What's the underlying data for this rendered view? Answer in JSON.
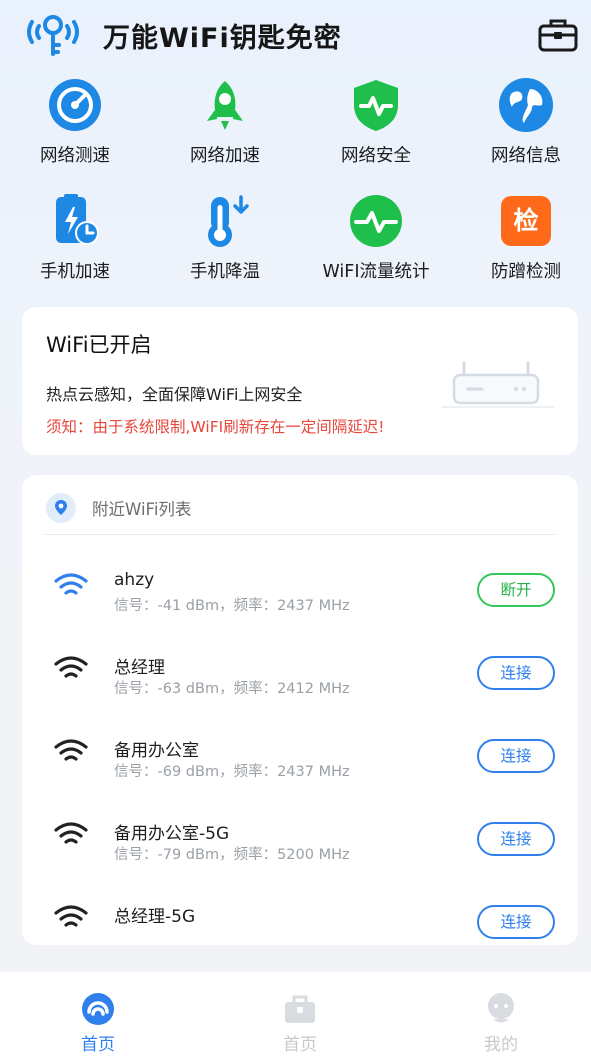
{
  "app_title": "万能WiFi钥匙免密",
  "icons": {
    "logo": "wifi-key-icon",
    "toolbox": "toolbox-icon"
  },
  "tools": [
    {
      "label": "网络测速",
      "icon": "speedometer-icon",
      "color": "#1e88e5"
    },
    {
      "label": "网络加速",
      "icon": "rocket-icon",
      "color": "#1fbf4b"
    },
    {
      "label": "网络安全",
      "icon": "shield-pulse-icon",
      "color": "#1fbf4b"
    },
    {
      "label": "网络信息",
      "icon": "globe-icon",
      "color": "#1e88e5"
    },
    {
      "label": "手机加速",
      "icon": "phone-boost-icon",
      "color": "#1e88e5"
    },
    {
      "label": "手机降温",
      "icon": "thermometer-icon",
      "color": "#1e88e5"
    },
    {
      "label": "WiFI流量统计",
      "icon": "traffic-pulse-icon",
      "color": "#1fbf4b"
    },
    {
      "label": "防蹭检测",
      "icon": "check-badge-icon",
      "badge_text": "检",
      "color": "#ff6a1a"
    }
  ],
  "status": {
    "title": "WiFi已开启",
    "desc": "热点云感知，全面保障WiFi上网安全",
    "warning": "须知：由于系统限制,WiFI刷新存在一定间隔延迟!"
  },
  "nearby": {
    "title": "附近WiFi列表",
    "networks": [
      {
        "ssid": "ahzy",
        "meta": "信号：-41 dBm，频率：2437 MHz",
        "action": "断开",
        "connected": true
      },
      {
        "ssid": "总经理",
        "meta": "信号：-63 dBm，频率：2412 MHz",
        "action": "连接",
        "connected": false
      },
      {
        "ssid": "备用办公室",
        "meta": "信号：-69 dBm，频率：2437 MHz",
        "action": "连接",
        "connected": false
      },
      {
        "ssid": "备用办公室-5G",
        "meta": "信号：-79 dBm，频率：5200 MHz",
        "action": "连接",
        "connected": false
      },
      {
        "ssid": "总经理-5G",
        "meta": "",
        "action": "连接",
        "connected": false
      }
    ]
  },
  "tabs": [
    {
      "label": "首页",
      "icon": "home-tab-icon",
      "active": true
    },
    {
      "label": "首页",
      "icon": "toolbox-tab-icon",
      "active": false
    },
    {
      "label": "我的",
      "icon": "profile-tab-icon",
      "active": false
    }
  ],
  "colors": {
    "accent": "#2f80ed",
    "success": "#34c759",
    "warning": "#e8473c"
  }
}
